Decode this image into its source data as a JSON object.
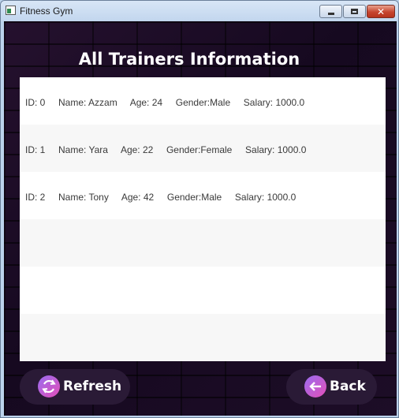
{
  "window": {
    "title": "Fitness Gym",
    "close_glyph": "✕"
  },
  "page": {
    "heading": "All Trainers Information"
  },
  "trainers": {
    "rows": [
      "ID: 0     Name: Azzam     Age: 24     Gender:Male     Salary: 1000.0",
      "ID: 1     Name: Yara     Age: 22     Gender:Female     Salary: 1000.0",
      "ID: 2     Name: Tony     Age: 42     Gender:Male     Salary: 1000.0"
    ]
  },
  "buttons": {
    "refresh_label": "Refresh",
    "back_label": "Back"
  },
  "icons": {
    "refresh": "refresh-icon",
    "back": "arrow-left-icon"
  },
  "colors": {
    "background": "#1a0b22",
    "button_bg": "#2a1a36",
    "icon_gradient_start": "#9a6cf0",
    "icon_gradient_end": "#e34fb8"
  }
}
